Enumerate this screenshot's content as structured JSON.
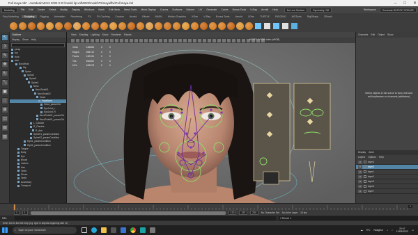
{
  "titlebar": {
    "title": "Full maya.mb* - Autodesk MAYA 2022.3: E:\\model lip voll\\2022\\model\\T2\\maya\\fbx\\Full maya.mb",
    "workspace_label": "Workspace",
    "workspace_value": "Generate RIGPOP CREATE"
  },
  "menubar": {
    "mode": "Modeling",
    "items": [
      "File",
      "Edit",
      "Create",
      "Select",
      "Modify",
      "Display",
      "Windows",
      "Mesh",
      "Edit Mesh",
      "Mesh Tools",
      "Mesh Display",
      "Curves",
      "Surfaces",
      "Deform",
      "UV",
      "Generate",
      "Cache",
      "Bonus Tools",
      "V-Ray",
      "Arnold",
      "Help"
    ],
    "live_surface": "No Live Surface",
    "symmetry": "Symmetry: Off",
    "sign_in": "Sign In"
  },
  "shelf": {
    "tabs": [
      "Poly Modeling",
      "Sculpting",
      "Rigging",
      "Animation",
      "Rendering",
      "FX",
      "FX Caching",
      "Custom",
      "Arnold",
      "Bifrost",
      "MASH",
      "Motion Graphics",
      "XGen",
      "V-Ray",
      "Bonus Tools",
      "Arnold",
      "XGen",
      "TURTLE",
      "RIGGING",
      "MGTools",
      "Rig2Maya",
      "ZBrush"
    ],
    "active_tab": "Sculpting",
    "tool_colors": [
      "#d8832a",
      "#d8832a",
      "#c96d1d",
      "#d8832a",
      "#e09a3c",
      "#d8832a",
      "#c96d1d",
      "#e0a050",
      "#d8832a",
      "#cf7a2a",
      "#d8832a",
      "#e09a3c",
      "#d8832a",
      "#c96d1d",
      "#d8832a",
      "#e0a050",
      "#d8832a",
      "#cf7a2a",
      "#d8832a",
      "#e09a3c",
      "#d8832a",
      "#c96d1d",
      "#d8832a",
      "#d8832a",
      "#c96d1d",
      "#e09a3c",
      "#d8832a"
    ],
    "right_colors": [
      "#6ec6ff",
      "#e0e0e0",
      "#6ec6ff",
      "#e0e0e0",
      "#5ab0e0"
    ]
  },
  "outliner": {
    "title": "Outliner",
    "menu": [
      "Display",
      "Show",
      "Help"
    ],
    "rows": [
      "persp",
      "top",
      "front",
      "side",
      "BondHost",
      "Hip",
      "Spine",
      "Spine1",
      "Spine2",
      "Spine3",
      "Neck",
      "NeckTwist01",
      "NeckTwist02",
      "Head",
      "FaceBone",
      "Head_paramCtrl",
      "EyeJoint_L",
      "EyeJoint_R",
      "NeckTwist01_paramCtrl",
      "NeckTwist01_paramCtrl",
      "L_Clavicle",
      "R_Clavicle",
      "R_Arm",
      "Spine01_paramCondition",
      "Spine02_paramCondition",
      "Hip01_paramCondition",
      "Hip02_paramCondition",
      "Tongue",
      "Body",
      "Eye",
      "Brows",
      "Lashes",
      "Hair",
      "Teeth",
      "Shoes",
      "Teeth",
      "Accessory",
      "Transport"
    ],
    "highlight_index": 14
  },
  "viewport": {
    "menu": [
      "View",
      "Shading",
      "Lighting",
      "Show",
      "Renderer",
      "Panels"
    ],
    "hud": [
      {
        "label": "Verts",
        "a": "136568",
        "b": "0",
        "c": "0"
      },
      {
        "label": "Edges",
        "a": "265710",
        "b": "0",
        "c": "0"
      },
      {
        "label": "Faces",
        "a": "130134",
        "b": "0",
        "c": "0"
      },
      {
        "label": "Tris",
        "a": "260262",
        "b": "0",
        "c": "0"
      },
      {
        "label": "UVs",
        "a": "163478",
        "b": "0",
        "c": "0"
      }
    ],
    "colorspace": "ACES 1.0 SDR-video (sRGB)"
  },
  "channelbox": {
    "menu": [
      "Channels",
      "Edit",
      "Object",
      "Show"
    ],
    "info": "Select objects in the scene to view, edit and add keyframes on channels (attributes)"
  },
  "layers": {
    "tabs": [
      "Display",
      "Anim"
    ],
    "menu": [
      "Layers",
      "Options",
      "Help"
    ],
    "rows": [
      {
        "name": "layer4",
        "vis": "V",
        "sel": false
      },
      {
        "name": "layer3",
        "vis": "V",
        "sel": true
      },
      {
        "name": "layer1",
        "vis": "V",
        "sel": false
      },
      {
        "name": "layer2",
        "vis": "V",
        "sel": false
      },
      {
        "name": "layer5",
        "vis": "V",
        "sel": false
      },
      {
        "name": "layer6",
        "vis": "V",
        "sel": false
      },
      {
        "name": "layer7",
        "vis": "V",
        "sel": false
      }
    ]
  },
  "timeline": {
    "current_frame": "1",
    "start": "1",
    "range_start": "1",
    "range_end": "120",
    "end": "120",
    "end2": "200",
    "no_character": "No Character Set",
    "no_anim_layer": "No Anim Layer",
    "fps": "24 fps"
  },
  "cmdline": {
    "lang": "MEL",
    "result": "// Result: 1"
  },
  "helpline": "Enter text to find the help (e.g. type in objects beginning with 'A')",
  "taskbar": {
    "search_placeholder": "Taper ici pour rechercher",
    "weather": "Nuageux",
    "temp": "9°C",
    "time": "20:47",
    "date": "12/05/2023"
  }
}
